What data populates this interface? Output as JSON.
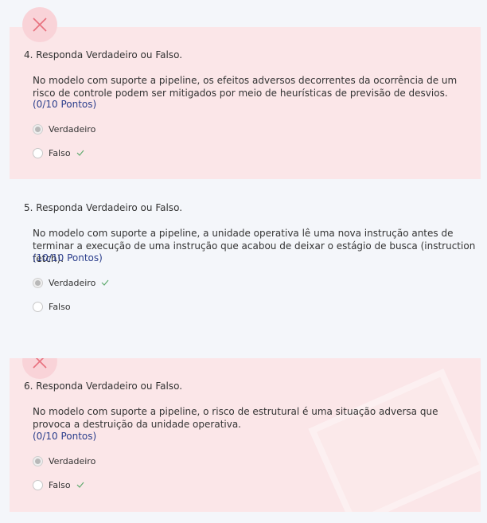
{
  "questions": [
    {
      "title": "4. Responda Verdadeiro ou Falso.",
      "text": "No modelo com suporte a pipeline, os efeitos adversos decorrentes da ocorrência de um risco de controle podem ser mitigados por meio de heurísticas de previsão de desvios.",
      "points": "(0/10 Pontos)",
      "status": "incorrect",
      "options": [
        {
          "label": "Verdadeiro",
          "selected": true,
          "correct": false
        },
        {
          "label": "Falso",
          "selected": false,
          "correct": true
        }
      ]
    },
    {
      "title": "5. Responda Verdadeiro ou Falso.",
      "text": "No modelo com suporte a pipeline, a unidade operativa lê uma nova instrução antes de terminar a execução de uma instrução que acabou de deixar o estágio de busca (instruction fetch).",
      "points": "(10/10 Pontos)",
      "status": "correct",
      "options": [
        {
          "label": "Verdadeiro",
          "selected": true,
          "correct": true
        },
        {
          "label": "Falso",
          "selected": false,
          "correct": false
        }
      ]
    },
    {
      "title": "6. Responda Verdadeiro ou Falso.",
      "text": "No modelo com suporte a pipeline, o risco de estrutural é uma situação adversa que provoca a destruição da unidade operativa.",
      "points": "(0/10 Pontos)",
      "status": "incorrect",
      "options": [
        {
          "label": "Verdadeiro",
          "selected": true,
          "correct": false
        },
        {
          "label": "Falso",
          "selected": false,
          "correct": true
        }
      ]
    }
  ],
  "colors": {
    "wrong_bg": "#fbe6e8",
    "x_badge": "#f9d3d8",
    "x_stroke": "#e8707e",
    "points_text": "#2b3e8c",
    "check": "#5aa86a"
  },
  "icons": {
    "incorrect": "close-icon",
    "correct_answer": "checkmark-icon"
  }
}
